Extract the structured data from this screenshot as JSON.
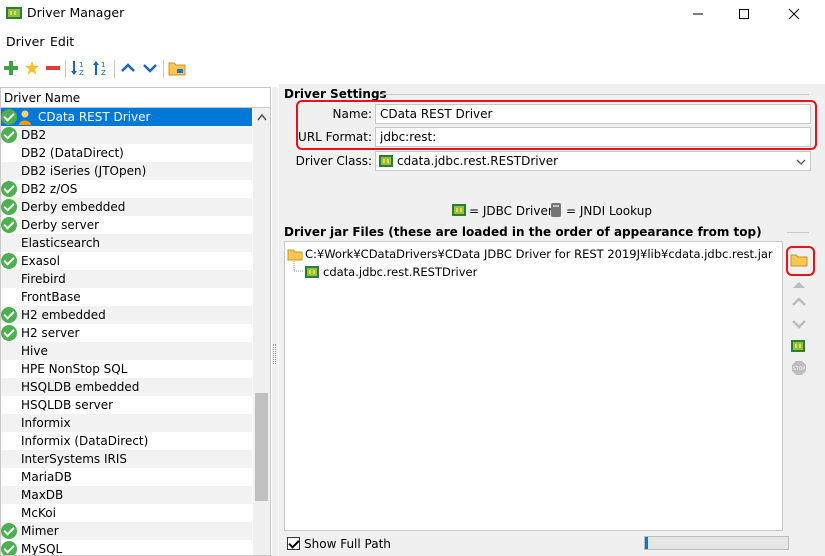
{
  "window": {
    "title": "Driver Manager"
  },
  "menu": {
    "items": [
      "Driver",
      "Edit"
    ]
  },
  "toolbar": {
    "buttons": [
      "add-icon",
      "star-icon",
      "remove-icon",
      "sort-asc-icon",
      "sort-desc-icon",
      "move-up-icon",
      "move-down-icon",
      "folder-icon"
    ]
  },
  "driver_list": {
    "header": "Driver Name",
    "items": [
      {
        "label": "CData REST Driver",
        "checked": true,
        "selected": true
      },
      {
        "label": "DB2",
        "checked": true
      },
      {
        "label": "DB2 (DataDirect)",
        "checked": false
      },
      {
        "label": "DB2 iSeries (JTOpen)",
        "checked": false
      },
      {
        "label": "DB2 z/OS",
        "checked": true
      },
      {
        "label": "Derby embedded",
        "checked": true
      },
      {
        "label": "Derby server",
        "checked": true
      },
      {
        "label": "Elasticsearch",
        "checked": false
      },
      {
        "label": "Exasol",
        "checked": true
      },
      {
        "label": "Firebird",
        "checked": false
      },
      {
        "label": "FrontBase",
        "checked": false
      },
      {
        "label": "H2 embedded",
        "checked": true
      },
      {
        "label": "H2 server",
        "checked": true
      },
      {
        "label": "Hive",
        "checked": false
      },
      {
        "label": "HPE NonStop SQL",
        "checked": false
      },
      {
        "label": "HSQLDB embedded",
        "checked": false
      },
      {
        "label": "HSQLDB server",
        "checked": false
      },
      {
        "label": "Informix",
        "checked": false
      },
      {
        "label": "Informix (DataDirect)",
        "checked": false
      },
      {
        "label": "InterSystems IRIS",
        "checked": false
      },
      {
        "label": "MariaDB",
        "checked": false
      },
      {
        "label": "MaxDB",
        "checked": false
      },
      {
        "label": "McKoi",
        "checked": false
      },
      {
        "label": "Mimer",
        "checked": true
      },
      {
        "label": "MySQL",
        "checked": true
      }
    ]
  },
  "driver_settings": {
    "title": "Driver Settings",
    "name_label": "Name:",
    "name_value": "CData REST Driver",
    "url_label": "URL Format:",
    "url_value": "jdbc:rest:",
    "class_label": "Driver Class:",
    "class_value": "cdata.jdbc.rest.RESTDriver"
  },
  "legend": {
    "jdbc": "= JDBC Driver",
    "jndi": "= JNDI Lookup"
  },
  "jar_files": {
    "title": "Driver jar Files (these are loaded in the order of appearance from top)",
    "path": "C:¥Work¥CDataDrivers¥CData JDBC Driver for REST 2019J¥lib¥cdata.jdbc.rest.jar",
    "class": "cdata.jdbc.rest.RESTDriver"
  },
  "footer": {
    "show_full_path": "Show Full Path",
    "progress": 0.02
  },
  "colors": {
    "accent": "#0078d7",
    "highlight": "#e0161c",
    "check": "#4caf50"
  }
}
